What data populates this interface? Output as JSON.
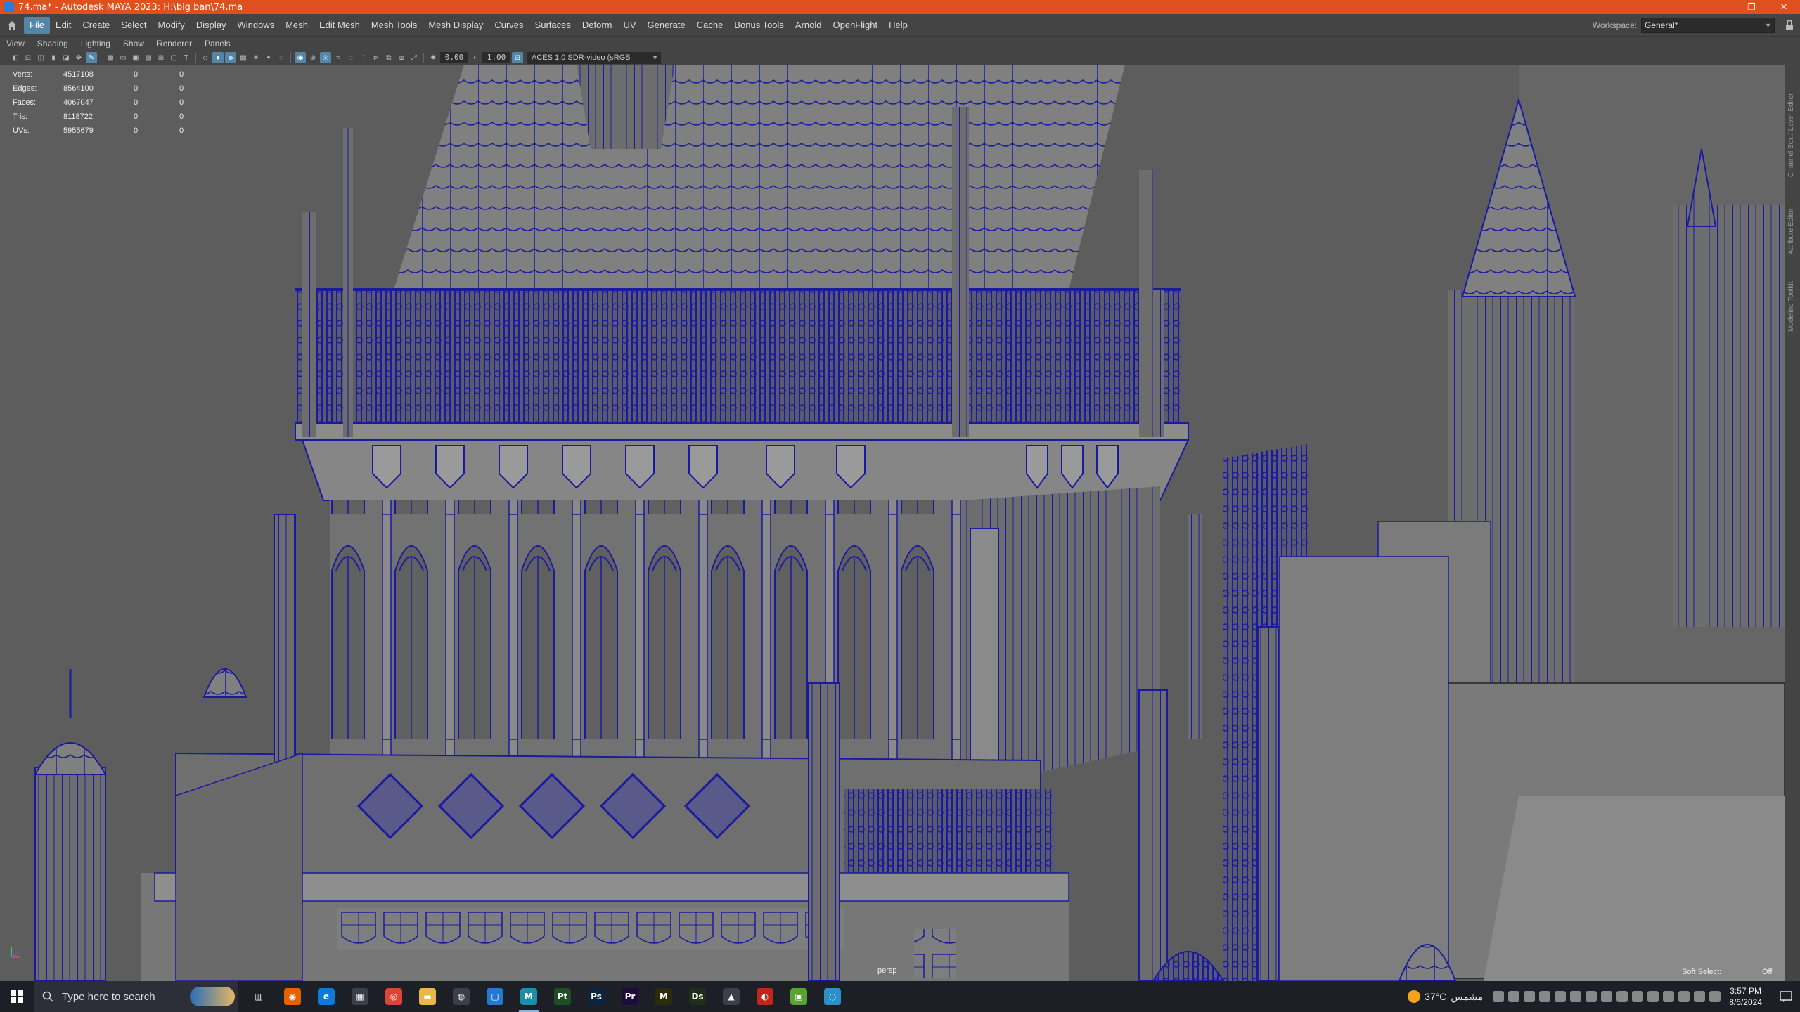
{
  "window": {
    "title": "74.ma* - Autodesk MAYA 2023: H:\\big ban\\74.ma",
    "controls": [
      "minimize-icon",
      "restore-icon",
      "close-icon"
    ]
  },
  "menubar": {
    "items": [
      "File",
      "Edit",
      "Create",
      "Select",
      "Modify",
      "Display",
      "Windows",
      "Mesh",
      "Edit Mesh",
      "Mesh Tools",
      "Mesh Display",
      "Curves",
      "Surfaces",
      "Deform",
      "UV",
      "Generate",
      "Cache",
      "Bonus Tools",
      "Arnold",
      "OpenFlight",
      "Help"
    ],
    "active": "File",
    "workspace_label": "Workspace:",
    "workspace_value": "General*"
  },
  "panel_menu": {
    "items": [
      "View",
      "Shading",
      "Lighting",
      "Show",
      "Renderer",
      "Panels"
    ]
  },
  "panel_toolbar": {
    "exposure": "0.00",
    "gamma": "1.00",
    "color_space": "ACES 1.0 SDR-video (sRGB"
  },
  "hud": {
    "rows": [
      {
        "label": "Verts:",
        "v1": "4517108",
        "v2": "0",
        "v3": "0"
      },
      {
        "label": "Edges:",
        "v1": "8564100",
        "v2": "0",
        "v3": "0"
      },
      {
        "label": "Faces:",
        "v1": "4067047",
        "v2": "0",
        "v3": "0"
      },
      {
        "label": "Tris:",
        "v1": "8118722",
        "v2": "0",
        "v3": "0"
      },
      {
        "label": "UVs:",
        "v1": "5955679",
        "v2": "0",
        "v3": "0"
      }
    ]
  },
  "viewport": {
    "camera": "persp",
    "soft_select_label": "Soft Select:",
    "soft_select_value": "Off",
    "wire_color": "#1a1aa0",
    "mesh_color": "#7a7a7a"
  },
  "sidebar": {
    "tabs": [
      "Channel Box / Layer Editor",
      "Attribute Editor",
      "Modeling Toolkit"
    ]
  },
  "taskbar": {
    "search_placeholder": "Type here to search",
    "apps": [
      {
        "name": "task-view-icon",
        "glyph": "▥",
        "color": "#1c1f26"
      },
      {
        "name": "firefox-icon",
        "glyph": "◉",
        "color": "#e66000"
      },
      {
        "name": "edge-icon",
        "glyph": "e",
        "color": "#0c7ad9"
      },
      {
        "name": "store-icon",
        "glyph": "▦",
        "color": "#3a3f4a"
      },
      {
        "name": "chrome-icon",
        "glyph": "◎",
        "color": "#db4437"
      },
      {
        "name": "file-explorer-icon",
        "glyph": "▬",
        "color": "#e6b84c"
      },
      {
        "name": "camera-app-icon",
        "glyph": "◍",
        "color": "#3a3f4a"
      },
      {
        "name": "app-blue-icon",
        "glyph": "▢",
        "color": "#2378d4"
      },
      {
        "name": "maya-icon",
        "glyph": "M",
        "color": "#1c8ea8"
      },
      {
        "name": "painter-icon",
        "glyph": "Pt",
        "color": "#1f4e24"
      },
      {
        "name": "photoshop-icon",
        "glyph": "Ps",
        "color": "#0b2440"
      },
      {
        "name": "premiere-icon",
        "glyph": "Pr",
        "color": "#1e0a3c"
      },
      {
        "name": "marvelous-icon",
        "glyph": "M",
        "color": "#2c2c0a"
      },
      {
        "name": "designer-icon",
        "glyph": "Ds",
        "color": "#1f2f1a"
      },
      {
        "name": "photos-icon",
        "glyph": "▲",
        "color": "#3a3f4a"
      },
      {
        "name": "app-red-icon",
        "glyph": "◐",
        "color": "#c0261a"
      },
      {
        "name": "app-green-icon",
        "glyph": "▣",
        "color": "#5aa32e"
      },
      {
        "name": "app-cyan-icon",
        "glyph": "◌",
        "color": "#2a90c8"
      }
    ],
    "active_app": "maya-icon",
    "weather_temp": "37°C",
    "weather_text": "مشمس",
    "time": "3:57 PM",
    "date": "8/6/2024"
  }
}
